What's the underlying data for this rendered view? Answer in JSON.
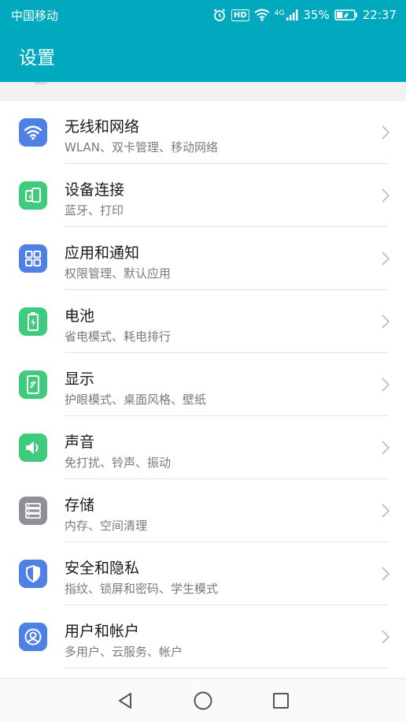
{
  "status_bar": {
    "carrier": "中国移动",
    "hd_badge": "HD",
    "network": "4G",
    "battery": "35%",
    "battery_level": 0.35,
    "time": "22:37"
  },
  "app_bar": {
    "title": "设置"
  },
  "colors": {
    "header": "#00a9be",
    "wifi_icon": "#4f81e4",
    "green_icon": "#3ecb7e",
    "gray_icon": "#8e9096",
    "blue_icon": "#4f81e4"
  },
  "settings_items": [
    {
      "title": "无线和网络",
      "subtitle": "WLAN、双卡管理、移动网络",
      "icon": "wifi-icon"
    },
    {
      "title": "设备连接",
      "subtitle": "蓝牙、打印",
      "icon": "device-connection-icon"
    },
    {
      "title": "应用和通知",
      "subtitle": "权限管理、默认应用",
      "icon": "apps-grid-icon"
    },
    {
      "title": "电池",
      "subtitle": "省电模式、耗电排行",
      "icon": "battery-icon"
    },
    {
      "title": "显示",
      "subtitle": "护眼模式、桌面风格、壁纸",
      "icon": "display-icon"
    },
    {
      "title": "声音",
      "subtitle": "免打扰、铃声、振动",
      "icon": "sound-icon"
    },
    {
      "title": "存储",
      "subtitle": "内存、空间清理",
      "icon": "storage-icon"
    },
    {
      "title": "安全和隐私",
      "subtitle": "指纹、锁屏和密码、学生模式",
      "icon": "shield-icon"
    },
    {
      "title": "用户和帐户",
      "subtitle": "多用户、云服务、帐户",
      "icon": "user-account-icon"
    }
  ],
  "nav_bar": [
    "back-icon",
    "home-icon",
    "recents-icon"
  ]
}
